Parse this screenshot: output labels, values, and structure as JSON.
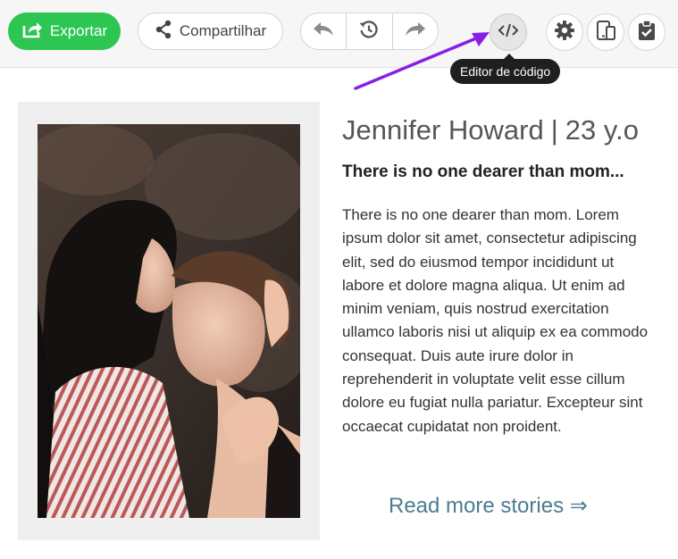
{
  "toolbar": {
    "export_label": "Exportar",
    "share_label": "Compartilhar",
    "icons": {
      "export": "export-icon",
      "share": "share-icon",
      "undo": "undo-arrow-icon",
      "history": "history-icon",
      "redo": "redo-arrow-icon",
      "code": "code-icon",
      "settings": "gear-icon",
      "devices": "devices-icon",
      "clipboard": "clipboard-check-icon"
    },
    "tooltip": "Editor de código"
  },
  "annotation": {
    "arrow_color": "#8a1ee6"
  },
  "card": {
    "name": "Jennifer Howard",
    "separator": "|",
    "age": "23 y.o",
    "headline": "There is no one dearer than mom...",
    "body": "There is no one dearer than mom. Lorem ipsum dolor sit amet, consectetur adipiscing elit, sed do eiusmod tempor incididunt ut labore et dolore magna aliqua. Ut enim ad minim veniam, quis nostrud exercitation ullamco laboris nisi ut aliquip ex ea commodo consequat. Duis aute irure dolor in reprehenderit in voluptate velit esse cillum dolore eu fugiat nulla pariatur. Excepteur sint occaecat cupidatat non proident.",
    "read_more": "Read more stories ⇒"
  },
  "colors": {
    "export_green": "#2ec652",
    "link": "#4b7d8f",
    "tooltip_bg": "#1f1f1f"
  }
}
